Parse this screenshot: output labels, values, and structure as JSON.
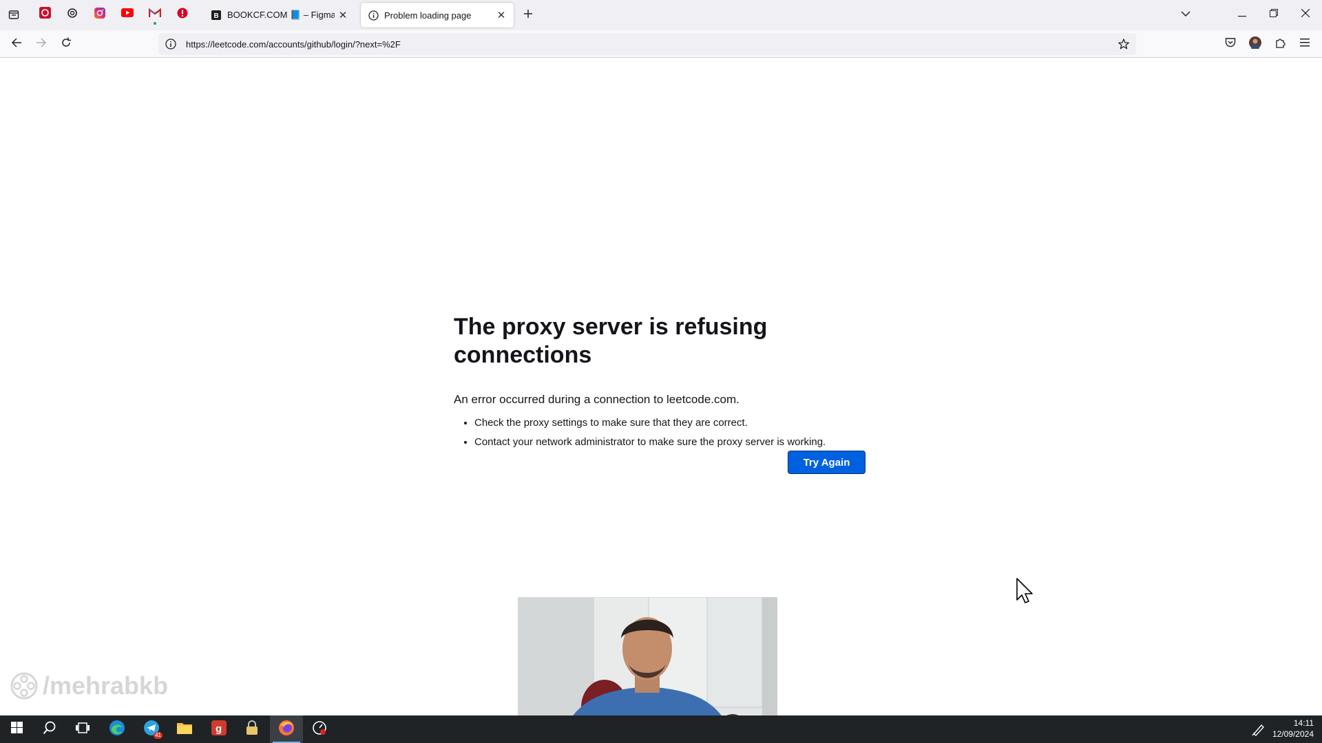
{
  "browser": {
    "tabs": [
      {
        "title": "BOOKCF.COM 📘 – Figma",
        "active": false
      },
      {
        "title": "Problem loading page",
        "active": true
      }
    ],
    "pinned_tabs": [
      "red-app-icon",
      "openai-icon",
      "instagram-icon",
      "youtube-icon",
      "gmail-icon",
      "alert-icon"
    ],
    "url": "https://leetcode.com/accounts/github/login/?next=%2F",
    "accent_color": "#0061e0"
  },
  "error_page": {
    "title": "The proxy server is refusing connections",
    "description": "An error occurred during a connection to leetcode.com.",
    "suggestions": [
      "Check the proxy settings to make sure that they are correct.",
      "Contact your network administrator to make sure the proxy server is working."
    ],
    "try_again_label": "Try Again"
  },
  "overlay": {
    "watermark": "/mehrabkb"
  },
  "taskbar": {
    "apps": [
      "windows-start-icon",
      "search-icon",
      "task-view-icon",
      "edge-icon",
      "telegram-icon",
      "file-explorer-icon",
      "app-g-icon",
      "app-lock-icon",
      "firefox-icon",
      "recorder-icon"
    ],
    "telegram_badge": "41",
    "time": "14:11",
    "date": "12/09/2024"
  }
}
